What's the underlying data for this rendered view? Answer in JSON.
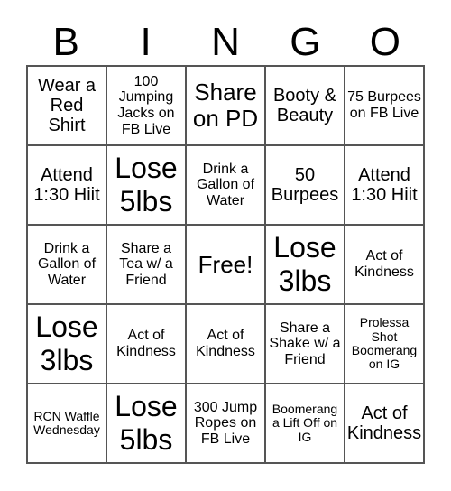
{
  "header": [
    "B",
    "I",
    "N",
    "G",
    "O"
  ],
  "cells": [
    {
      "text": "Wear a Red Shirt",
      "size": "s3"
    },
    {
      "text": "100 Jumping Jacks on FB Live",
      "size": "s2"
    },
    {
      "text": "Share on PD",
      "size": "s4"
    },
    {
      "text": "Booty & Beauty",
      "size": "s3"
    },
    {
      "text": "75 Burpees on FB Live",
      "size": "s2"
    },
    {
      "text": "Attend 1:30 Hiit",
      "size": "s3"
    },
    {
      "text": "Lose 5lbs",
      "size": "s5"
    },
    {
      "text": "Drink a Gallon of Water",
      "size": "s2"
    },
    {
      "text": "50 Burpees",
      "size": "s3"
    },
    {
      "text": "Attend 1:30 Hiit",
      "size": "s3"
    },
    {
      "text": "Drink a Gallon of Water",
      "size": "s2"
    },
    {
      "text": "Share a Tea w/ a Friend",
      "size": "s2"
    },
    {
      "text": "Free!",
      "size": "s4"
    },
    {
      "text": "Lose 3lbs",
      "size": "s5"
    },
    {
      "text": "Act of Kindness",
      "size": "s2"
    },
    {
      "text": "Lose 3lbs",
      "size": "s5"
    },
    {
      "text": "Act of Kindness",
      "size": "s2"
    },
    {
      "text": "Act of Kindness",
      "size": "s2"
    },
    {
      "text": "Share a Shake w/ a Friend",
      "size": "s2"
    },
    {
      "text": "Prolessa Shot Boomerang on IG",
      "size": "s1"
    },
    {
      "text": "RCN Waffle Wednesday",
      "size": "s1"
    },
    {
      "text": "Lose 5lbs",
      "size": "s5"
    },
    {
      "text": "300 Jump Ropes on FB Live",
      "size": "s2"
    },
    {
      "text": "Boomerang a Lift Off on IG",
      "size": "s1"
    },
    {
      "text": "Act of Kindness",
      "size": "s3"
    }
  ]
}
